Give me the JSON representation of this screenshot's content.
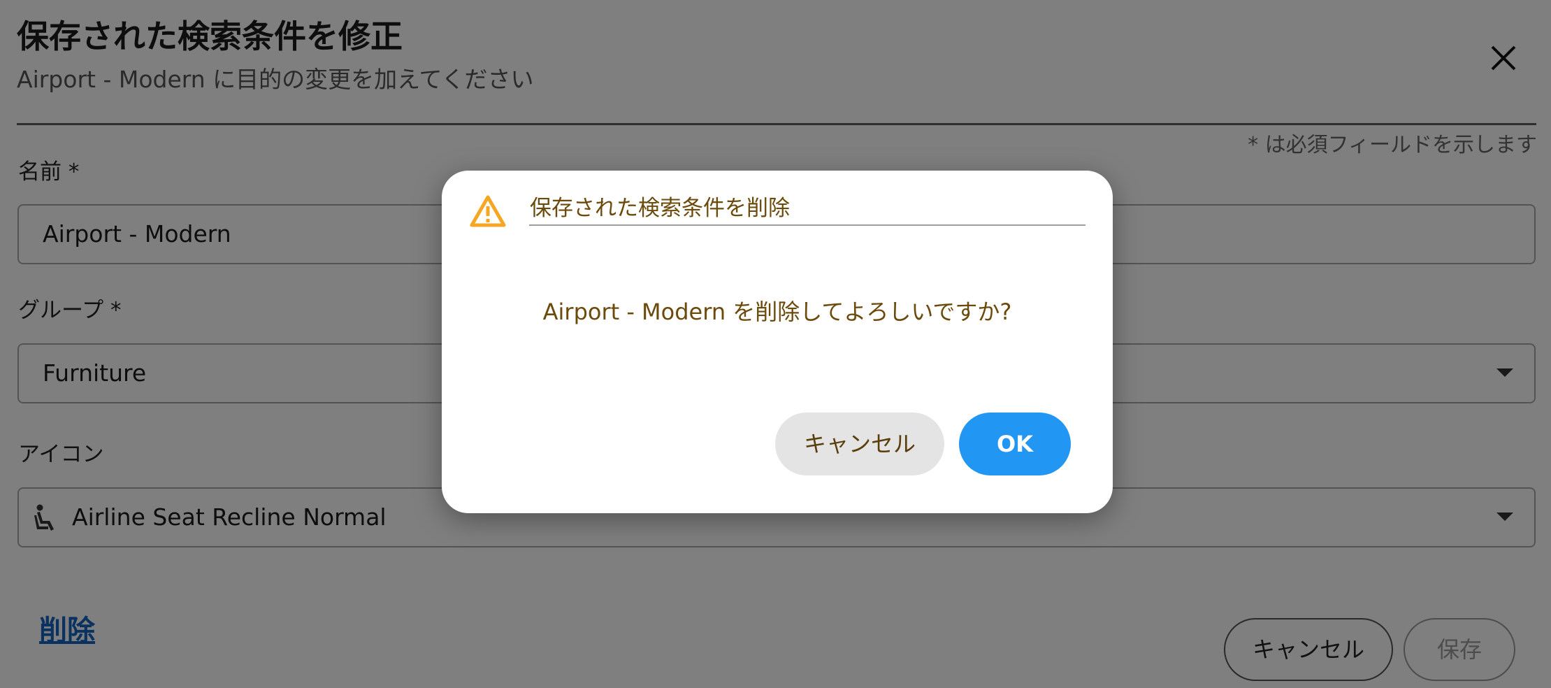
{
  "form": {
    "title": "保存された検索条件を修正",
    "subtitle": "Airport - Modern に目的の変更を加えてください",
    "required_note": "* は必須フィールドを示します",
    "name_label": "名前 *",
    "name_value": "Airport - Modern",
    "group_label": "グループ *",
    "group_value": "Furniture",
    "icon_label": "アイコン",
    "icon_value": "Airline Seat Recline Normal",
    "icon_name": "airline-seat-recline-normal-icon",
    "delete_link": "削除",
    "cancel_label": "キャンセル",
    "save_label": "保存"
  },
  "dialog": {
    "title": "保存された検索条件を削除",
    "message": "Airport - Modern を削除してよろしいですか?",
    "cancel_label": "キャンセル",
    "ok_label": "OK",
    "icon_name": "warning-icon"
  },
  "colors": {
    "accent": "#2196f3",
    "warning": "#f5a623",
    "dialog_text": "#6b4a0b",
    "link": "#1565c0"
  }
}
